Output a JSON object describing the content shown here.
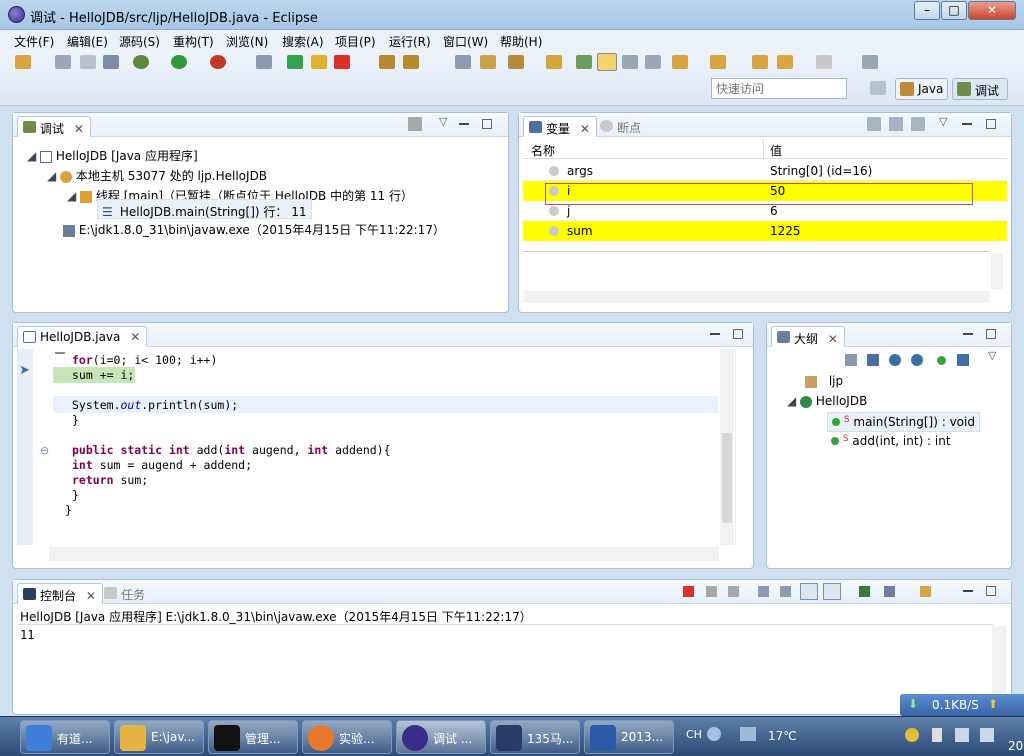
{
  "window": {
    "title": "调试 - HelloJDB/src/ljp/HelloJDB.java - Eclipse"
  },
  "menu": [
    "文件(F)",
    "编辑(E)",
    "源码(S)",
    "重构(T)",
    "浏览(N)",
    "搜索(A)",
    "项目(P)",
    "运行(R)",
    "窗口(W)",
    "帮助(H)"
  ],
  "toolbar": {
    "quick_access_placeholder": "快速访问",
    "perspective_java": "Java",
    "perspective_debug": "调试"
  },
  "debug_view": {
    "tab": "调试",
    "tree": [
      "HelloJDB [Java 应用程序]",
      "本地主机 53077 处的 ljp.HelloJDB",
      "线程 [main]（已暂挂（断点位于 HelloJDB 中的第 11 行）",
      "HelloJDB.main(String[]) 行： 11",
      "E:\\jdk1.8.0_31\\bin\\javaw.exe（2015年4月15日 下午11:22:17）"
    ]
  },
  "variables_view": {
    "tab": "变量",
    "inactive_tab": "断点",
    "col_name": "名称",
    "col_value": "值",
    "rows": [
      {
        "name": "args",
        "value": "String[0]  (id=16)"
      },
      {
        "name": "i",
        "value": "50"
      },
      {
        "name": "j",
        "value": "6"
      },
      {
        "name": "sum",
        "value": "1225"
      }
    ],
    "highlight_color": "#ffff00",
    "selection_box_color": "#c0504d"
  },
  "editor": {
    "tab": "HelloJDB.java",
    "lines": [
      {
        "plain": "for(i=0; i< 100; i++)"
      },
      {
        "plain": "sum += i;"
      },
      {
        "plain": "System.out.println(sum);"
      },
      {
        "plain": "}"
      },
      {
        "plain": "public static int add(int augend, int addend){"
      },
      {
        "plain": "int sum = augend + addend;"
      },
      {
        "plain": "return sum;"
      },
      {
        "plain": "}"
      },
      {
        "plain": "}"
      }
    ],
    "current_line_color": "#c6e6b5"
  },
  "outline_view": {
    "tab": "大纲",
    "items": [
      "ljp",
      "HelloJDB",
      "main(String[]) : void",
      "add(int, int) : int"
    ]
  },
  "console_view": {
    "tab": "控制台",
    "inactive_tab": "任务",
    "header": "HelloJDB [Java 应用程序] E:\\jdk1.8.0_31\\bin\\javaw.exe（2015年4月15日 下午11:22:17）",
    "output": "11"
  },
  "taskbar": {
    "tasks": [
      "有道...",
      "E:\\jav...",
      "管理...",
      "实验...",
      "调试 ...",
      "135马...",
      "2013..."
    ],
    "net_speed": "0.1KB/S",
    "ime": "CH",
    "temperature": "17℃",
    "clock_partial": "20"
  }
}
